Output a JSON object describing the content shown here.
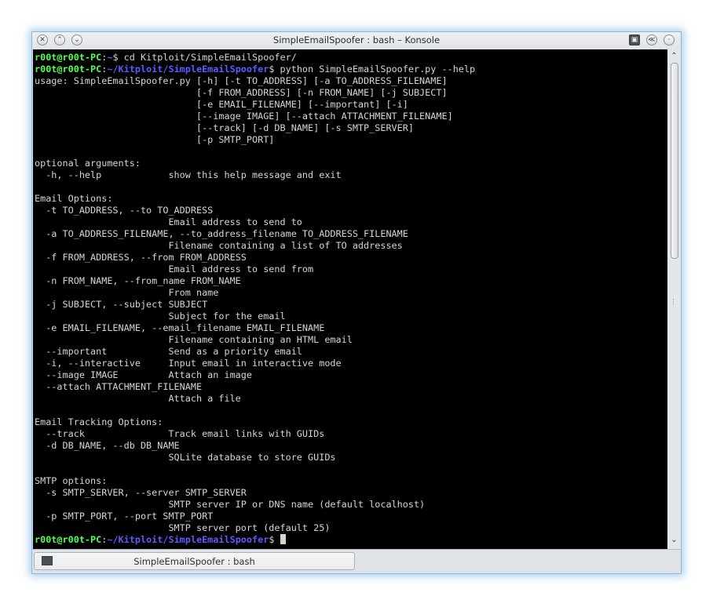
{
  "window": {
    "title": "SimpleEmailSpoofer : bash – Konsole",
    "close_glyph": "✕",
    "minimize_glyph": "⌃",
    "maximize_glyph": "⌄",
    "keep_above_glyph": "≪",
    "menu_glyph": "▣",
    "shade_glyph": "·"
  },
  "prompt": {
    "user_host": "r00t@r00t-PC",
    "colon": ":"
  },
  "terminal": {
    "line1": {
      "path": "~",
      "cmd": "$ cd Kitploit/SimpleEmailSpoofer/"
    },
    "line2": {
      "path": "~/Kitploit/SimpleEmailSpoofer",
      "cmd": "$ python SimpleEmailSpoofer.py --help"
    },
    "output": [
      "usage: SimpleEmailSpoofer.py [-h] [-t TO_ADDRESS] [-a TO_ADDRESS_FILENAME]",
      "                             [-f FROM_ADDRESS] [-n FROM_NAME] [-j SUBJECT]",
      "                             [-e EMAIL_FILENAME] [--important] [-i]",
      "                             [--image IMAGE] [--attach ATTACHMENT_FILENAME]",
      "                             [--track] [-d DB_NAME] [-s SMTP_SERVER]",
      "                             [-p SMTP_PORT]",
      "",
      "optional arguments:",
      "  -h, --help            show this help message and exit",
      "",
      "Email Options:",
      "  -t TO_ADDRESS, --to TO_ADDRESS",
      "                        Email address to send to",
      "  -a TO_ADDRESS_FILENAME, --to_address_filename TO_ADDRESS_FILENAME",
      "                        Filename containing a list of TO addresses",
      "  -f FROM_ADDRESS, --from FROM_ADDRESS",
      "                        Email address to send from",
      "  -n FROM_NAME, --from_name FROM_NAME",
      "                        From name",
      "  -j SUBJECT, --subject SUBJECT",
      "                        Subject for the email",
      "  -e EMAIL_FILENAME, --email_filename EMAIL_FILENAME",
      "                        Filename containing an HTML email",
      "  --important           Send as a priority email",
      "  -i, --interactive     Input email in interactive mode",
      "  --image IMAGE         Attach an image",
      "  --attach ATTACHMENT_FILENAME",
      "                        Attach a file",
      "",
      "Email Tracking Options:",
      "  --track               Track email links with GUIDs",
      "  -d DB_NAME, --db DB_NAME",
      "                        SQLite database to store GUIDs",
      "",
      "SMTP options:",
      "  -s SMTP_SERVER, --server SMTP_SERVER",
      "                        SMTP server IP or DNS name (default localhost)",
      "  -p SMTP_PORT, --port SMTP_PORT",
      "                        SMTP server port (default 25)"
    ],
    "last": {
      "path": "~/Kitploit/SimpleEmailSpoofer",
      "cmd": "$ "
    }
  },
  "scrollbar": {
    "up_glyph": "⌃",
    "down_glyph": "⌄"
  },
  "tabs": [
    {
      "label": "SimpleEmailSpoofer : bash"
    }
  ],
  "colors": {
    "terminal_bg": "#000000",
    "terminal_fg": "#d5d5d5",
    "prompt_user": "#54ff54",
    "prompt_path": "#5c5cff"
  }
}
